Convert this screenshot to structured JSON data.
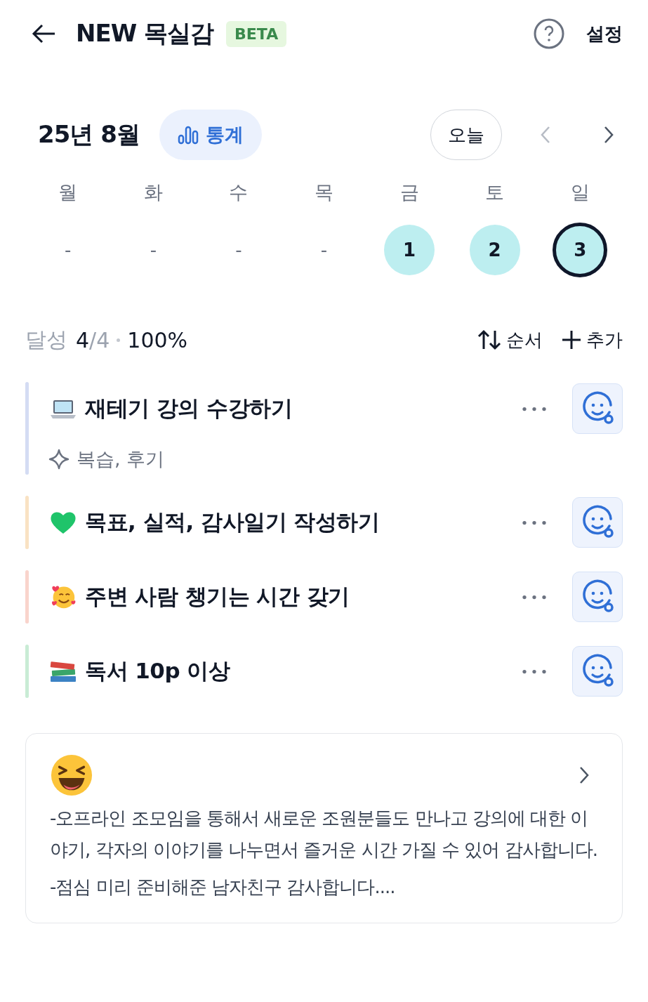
{
  "header": {
    "title": "NEW 목실감",
    "badge": "BETA",
    "settings": "설정"
  },
  "month": {
    "label": "25년 8월",
    "stats": "통계",
    "today": "오늘"
  },
  "weekdays": [
    "월",
    "화",
    "수",
    "목",
    "금",
    "토",
    "일"
  ],
  "days": [
    {
      "label": "-",
      "kind": "empty",
      "selected": false
    },
    {
      "label": "-",
      "kind": "empty",
      "selected": false
    },
    {
      "label": "-",
      "kind": "empty",
      "selected": false
    },
    {
      "label": "-",
      "kind": "empty",
      "selected": false
    },
    {
      "label": "1",
      "kind": "date",
      "selected": false
    },
    {
      "label": "2",
      "kind": "date",
      "selected": false
    },
    {
      "label": "3",
      "kind": "date",
      "selected": true
    }
  ],
  "summary": {
    "label": "달성",
    "done": "4",
    "total": "/4",
    "percent": "100%",
    "sort": "순서",
    "add": "추가"
  },
  "tasks": [
    {
      "kind": "laptop",
      "title": "재테기 강의 수강하기",
      "color": "#d4dcf3",
      "tags": "복습, 후기"
    },
    {
      "kind": "heart",
      "title": "목표, 실적, 감사일기 작성하기",
      "color": "#f9e2c3"
    },
    {
      "kind": "love",
      "title": "주변 사람 챙기는 시간 갖기",
      "color": "#f9d4cc"
    },
    {
      "kind": "books",
      "title": "독서 10p 이상",
      "color": "#c9ecd5"
    }
  ],
  "note": {
    "kind": "laugh",
    "lines": [
      "-오프라인 조모임을 통해서 새로운 조원분들도 만나고 강의에 대한 이야기, 각자의 이야기를 나누면서 즐거운 시간 가질 수 있어 감사합니다.",
      "-점심 미리 준비해준 남자친구 감사합니다...."
    ]
  }
}
